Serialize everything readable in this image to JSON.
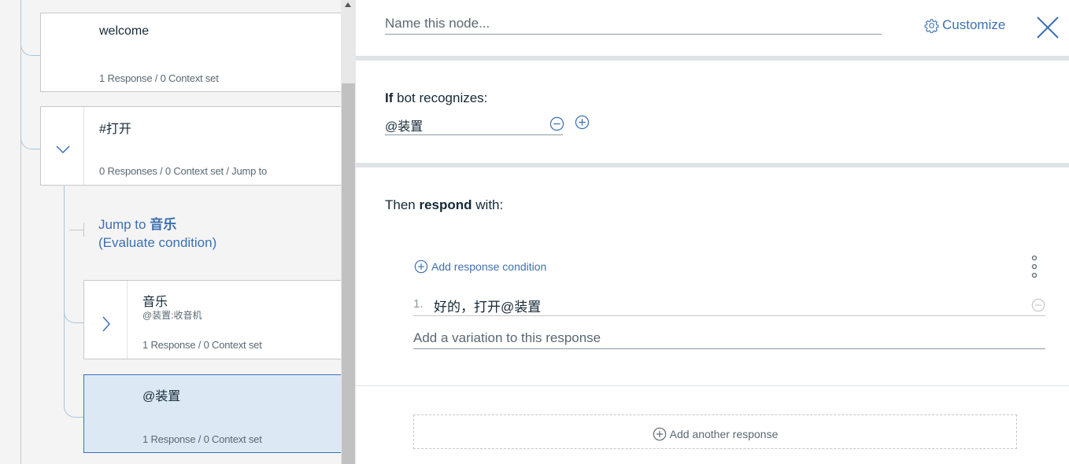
{
  "tree": {
    "nodes": [
      {
        "title": "welcome",
        "meta": "1 Response / 0 Context set"
      },
      {
        "title": "#打开",
        "meta": "0 Responses / 0 Context set / Jump to"
      },
      {
        "title": "音乐",
        "condition": "@装置:收音机",
        "meta": "1 Response / 0 Context set"
      },
      {
        "title": "@装置",
        "meta": "1 Response / 0 Context set"
      }
    ],
    "jump": {
      "prefix": "Jump to",
      "target": "音乐",
      "mode": "(Evaluate condition)"
    }
  },
  "editor": {
    "name_placeholder": "Name this node...",
    "customize_label": "Customize",
    "if_bold": "If",
    "if_rest": " bot recognizes:",
    "condition_value": "@装置",
    "then_pre": "Then ",
    "then_bold": "respond",
    "then_post": " with:",
    "add_condition_label": "Add response condition",
    "responses": [
      {
        "number": "1.",
        "text": "好的，打开@装置"
      }
    ],
    "variation_placeholder": "Add a variation to this response",
    "add_response_label": "Add another response"
  },
  "colors": {
    "accent": "#3d70b2",
    "selected_bg": "#dce9f5",
    "border": "#c7c7c7"
  }
}
